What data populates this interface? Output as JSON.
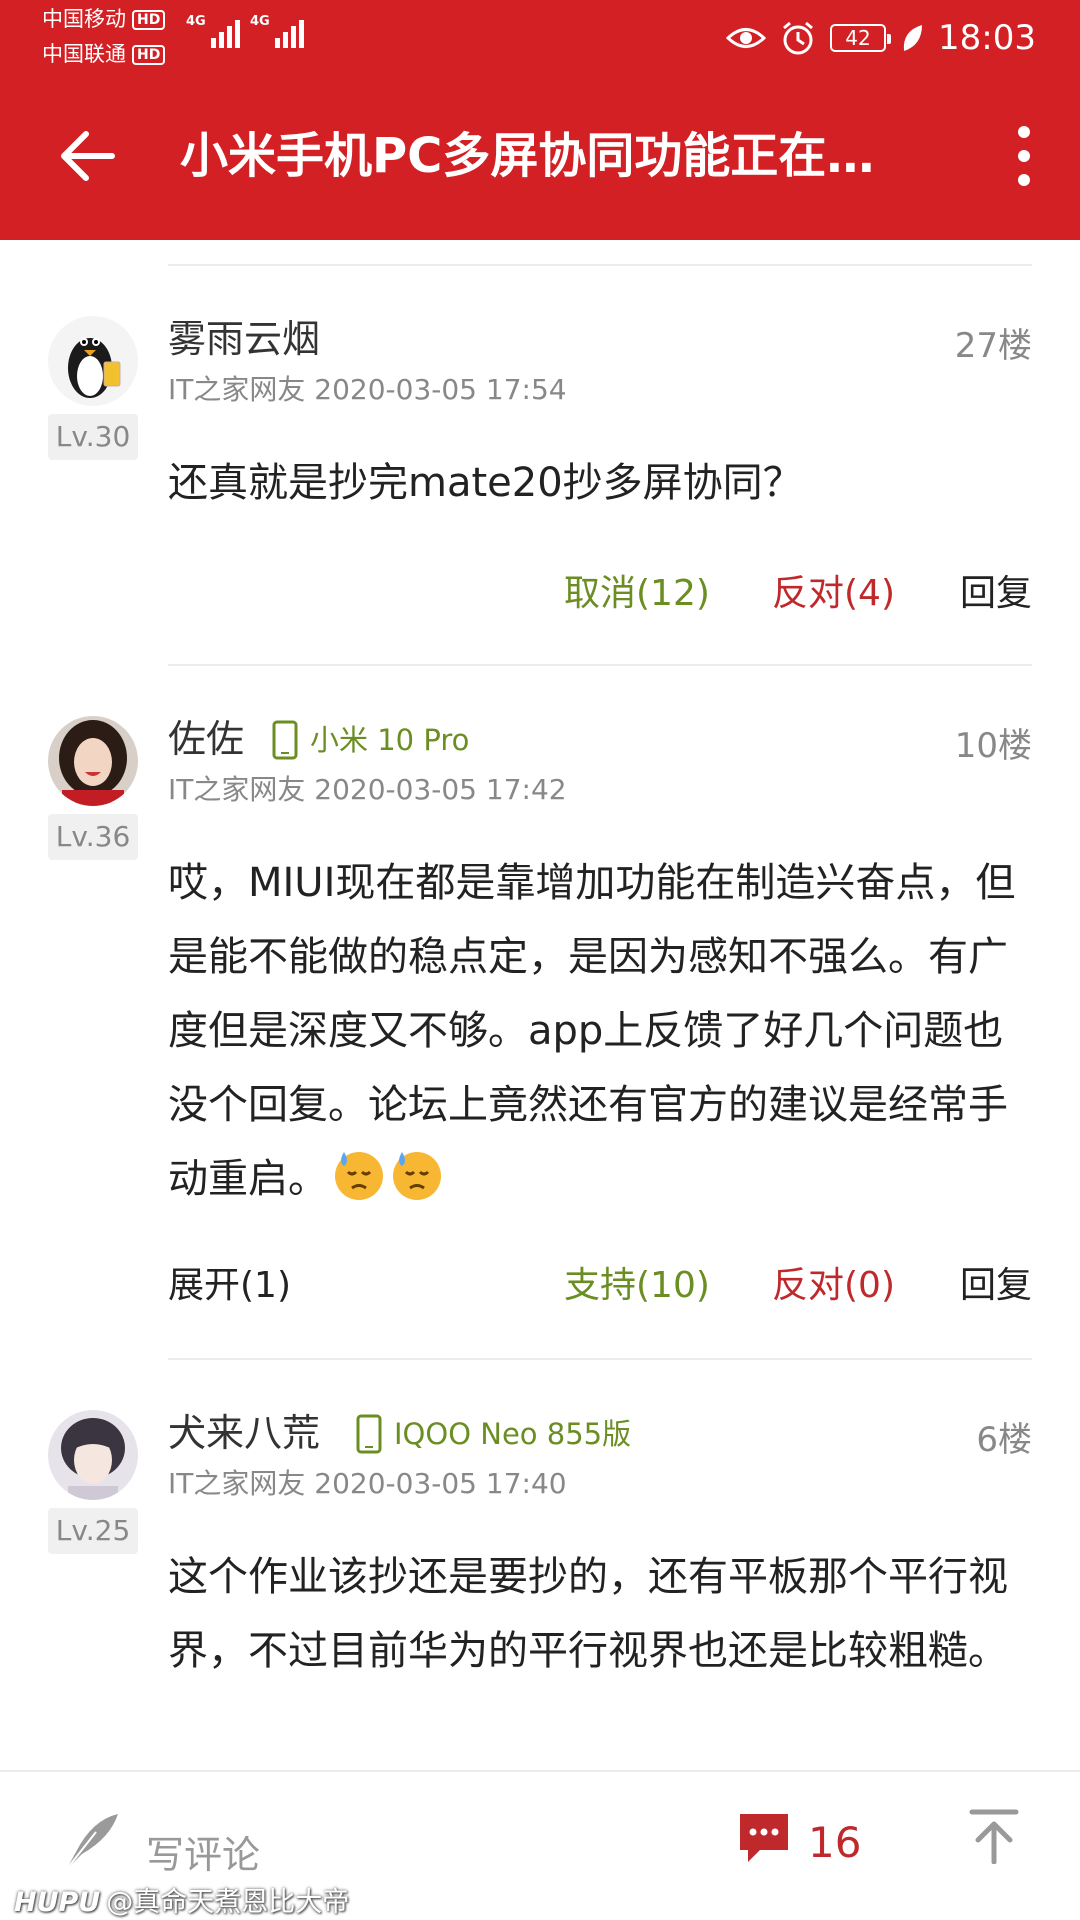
{
  "status_bar": {
    "carrier1": "中国移动",
    "carrier2": "中国联通",
    "hd_badge": "HD",
    "network1": "4G",
    "network2": "4G",
    "battery": "42",
    "time": "18:03"
  },
  "appbar": {
    "title": "小米手机PC多屏协同功能正在…",
    "back_icon": "arrow-left-icon",
    "menu_icon": "more-vertical-icon"
  },
  "comments": [
    {
      "username": "雾雨云烟",
      "device": "",
      "floor": "27楼",
      "meta": "IT之家网友 2020-03-05 17:54",
      "level": "Lv.30",
      "body": "还真就是抄完mate20抄多屏协同？",
      "expand": "",
      "support": "取消(12)",
      "oppose": "反对(4)",
      "reply": "回复"
    },
    {
      "username": "佐佐",
      "device": "小米 10 Pro",
      "floor": "10楼",
      "meta": "IT之家网友 2020-03-05 17:42",
      "level": "Lv.36",
      "body": "哎，MIUI现在都是靠增加功能在制造兴奋点，但是能不能做的稳点定，是因为感知不强么。有广度但是深度又不够。app上反馈了好几个问题也没个回复。论坛上竟然还有官方的建议是经常手动重启。",
      "expand": "展开(1)",
      "support": "支持(10)",
      "oppose": "反对(0)",
      "reply": "回复"
    },
    {
      "username": "犬来八荒",
      "device": "IQOO Neo 855版",
      "floor": "6楼",
      "meta": "IT之家网友 2020-03-05 17:40",
      "level": "Lv.25",
      "body": "这个作业该抄还是要抄的，还有平板那个平行视界，不过目前华为的平行视界也还是比较粗糙。"
    }
  ],
  "bottom_bar": {
    "write_label": "写评论",
    "comment_count": "16"
  },
  "watermark": {
    "brand": "HUPU",
    "user": "@真命天煮恩比大帝"
  },
  "colors": {
    "brand_red": "#d32024",
    "support_green": "#6b8e23",
    "oppose_red": "#c0292c"
  }
}
